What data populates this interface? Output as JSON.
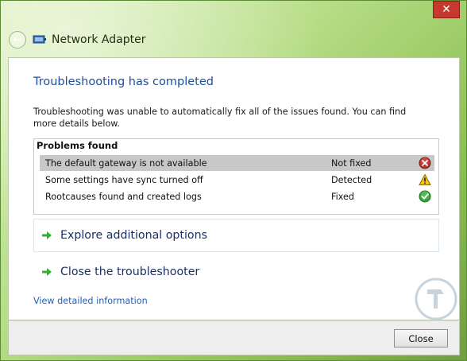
{
  "window": {
    "title": "Network Adapter",
    "close_glyph": "✕",
    "back_glyph": "←"
  },
  "main": {
    "heading": "Troubleshooting has completed",
    "description": "Troubleshooting was unable to automatically fix all of the issues found. You can find more details below."
  },
  "problems": {
    "header": "Problems found",
    "rows": [
      {
        "name": "The default gateway is not available",
        "status": "Not fixed",
        "icon": "error-icon",
        "selected": true
      },
      {
        "name": "Some settings have sync turned off",
        "status": "Detected",
        "icon": "warning-icon",
        "selected": false
      },
      {
        "name": "Rootcauses found and created logs",
        "status": "Fixed",
        "icon": "check-icon",
        "selected": false
      }
    ]
  },
  "options": {
    "explore": "Explore additional options",
    "close_troubleshooter": "Close the troubleshooter"
  },
  "links": {
    "details": "View detailed information"
  },
  "footer": {
    "close_label": "Close"
  },
  "colors": {
    "heading": "#1e4e99",
    "link": "#1f5fb8",
    "option_text": "#1a2f66",
    "error_red": "#c0392b",
    "warning_yellow": "#f2c40c",
    "fixed_green": "#3aa53a",
    "arrow_green": "#2db32d",
    "selected_row": "#c8c8c8"
  }
}
